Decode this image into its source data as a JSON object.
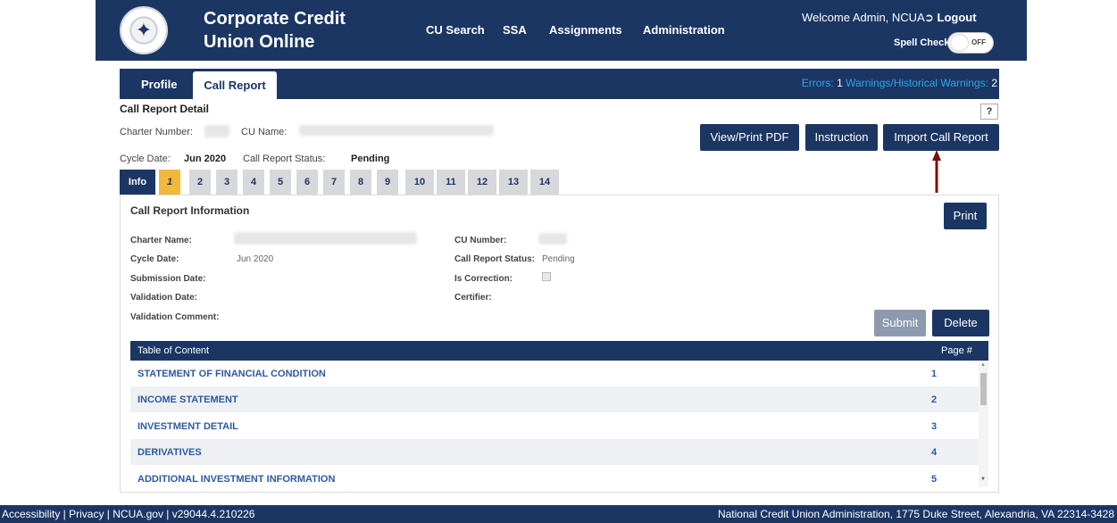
{
  "header": {
    "title_line1": "Corporate Credit",
    "title_line2": "Union Online",
    "nav": [
      "CU Search",
      "SSA",
      "Assignments",
      "Administration"
    ],
    "welcome": "Welcome Admin, NCUA",
    "logout": "Logout",
    "spell_check_label": "Spell Check",
    "spell_check_state": "OFF"
  },
  "subnav": {
    "tabs": [
      "Profile",
      "Call Report"
    ],
    "errors_label": "Errors:",
    "errors_count": "1",
    "warnings_label": "Warnings/Historical Warnings:",
    "warnings_count": "2"
  },
  "detail": {
    "title": "Call Report Detail",
    "help": "?",
    "charter_number_label": "Charter Number:",
    "cu_name_label": "CU Name:",
    "cycle_date_label": "Cycle Date:",
    "cycle_date": "Jun 2020",
    "status_label": "Call Report Status:",
    "status": "Pending",
    "buttons": [
      "View/Print PDF",
      "Instruction",
      "Import Call Report"
    ]
  },
  "page_tabs": [
    "Info",
    "1",
    "2",
    "3",
    "4",
    "5",
    "6",
    "7",
    "8",
    "9",
    "10",
    "11",
    "12",
    "13",
    "14"
  ],
  "info": {
    "title": "Call Report Information",
    "print": "Print",
    "charter_name_label": "Charter Name:",
    "cycle_date_label": "Cycle Date:",
    "cycle_date": "Jun 2020",
    "submission_date_label": "Submission Date:",
    "validation_date_label": "Validation Date:",
    "validation_comment_label": "Validation Comment:",
    "cu_number_label": "CU Number:",
    "status_label": "Call Report Status:",
    "status": "Pending",
    "is_correction_label": "Is Correction:",
    "certifier_label": "Certifier:",
    "submit": "Submit",
    "delete": "Delete"
  },
  "toc": {
    "header": "Table of Content",
    "page_header": "Page #",
    "rows": [
      {
        "name": "STATEMENT OF FINANCIAL CONDITION",
        "page": "1"
      },
      {
        "name": "INCOME STATEMENT",
        "page": "2"
      },
      {
        "name": "INVESTMENT DETAIL",
        "page": "3"
      },
      {
        "name": "DERIVATIVES",
        "page": "4"
      },
      {
        "name": "ADDITIONAL INVESTMENT INFORMATION",
        "page": "5"
      }
    ]
  },
  "footer": {
    "left": "Accessibility | Privacy | NCUA.gov | v29044.4.210226",
    "right": "National Credit Union Administration, 1775 Duke Street, Alexandria, VA 22314-3428"
  },
  "colors": {
    "navy": "#1c3664",
    "active_tab": "#f0b93b",
    "link": "#2c5aa0",
    "arrow": "#7a1010"
  }
}
